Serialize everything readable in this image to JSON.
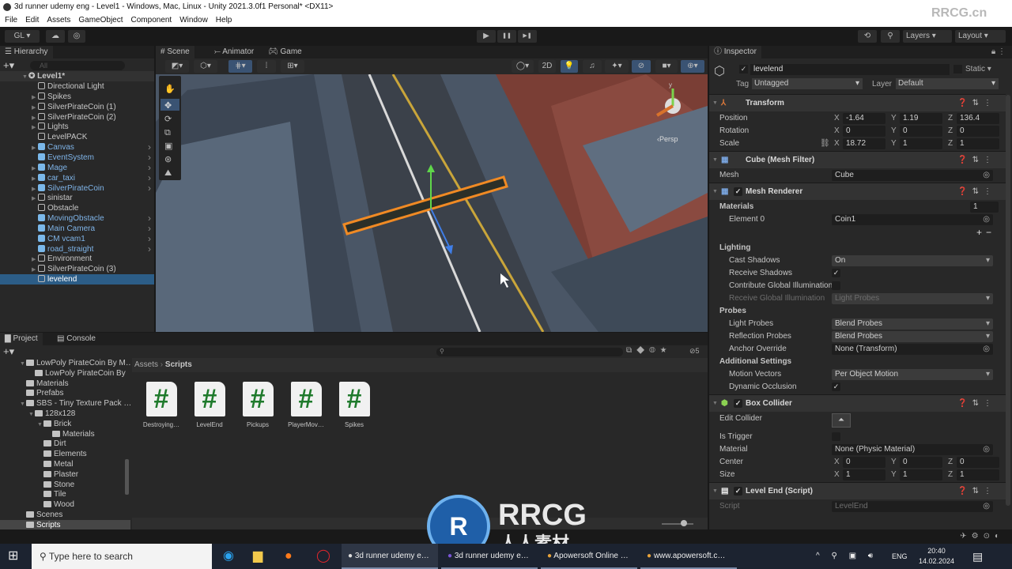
{
  "window": {
    "title": "3d runner udemy eng - Level1 - Windows, Mac, Linux - Unity 2021.3.0f1 Personal* <DX11>"
  },
  "menu": [
    "File",
    "Edit",
    "Assets",
    "GameObject",
    "Component",
    "Window",
    "Help"
  ],
  "toolbar": {
    "account": "GL ▾",
    "layers": "Layers",
    "layout": "Layout",
    "play": "▶",
    "pause": "❚❚",
    "step": "▶❚"
  },
  "hierarchy": {
    "tab": "Hierarchy",
    "search_placeholder": "All",
    "scene": "Level1*",
    "items": [
      {
        "name": "Directional Light",
        "prefab": false,
        "expandable": false,
        "selected": false
      },
      {
        "name": "Spikes",
        "prefab": false,
        "expandable": true,
        "selected": false
      },
      {
        "name": "SilverPirateCoin (1)",
        "prefab": false,
        "expandable": true,
        "selected": false
      },
      {
        "name": "SilverPirateCoin (2)",
        "prefab": false,
        "expandable": true,
        "selected": false
      },
      {
        "name": "Lights",
        "prefab": false,
        "expandable": true,
        "selected": false
      },
      {
        "name": "LevelPACK",
        "prefab": false,
        "expandable": false,
        "selected": false
      },
      {
        "name": "Canvas",
        "prefab": true,
        "expandable": true,
        "selected": false
      },
      {
        "name": "EventSystem",
        "prefab": true,
        "expandable": false,
        "selected": false
      },
      {
        "name": "Mage",
        "prefab": true,
        "expandable": true,
        "selected": false
      },
      {
        "name": "car_taxi",
        "prefab": true,
        "expandable": true,
        "selected": false
      },
      {
        "name": "SilverPirateCoin",
        "prefab": true,
        "expandable": true,
        "selected": false
      },
      {
        "name": "sinistar",
        "prefab": false,
        "expandable": true,
        "selected": false
      },
      {
        "name": "Obstacle",
        "prefab": false,
        "expandable": false,
        "selected": false
      },
      {
        "name": "MovingObstacle",
        "prefab": true,
        "expandable": false,
        "selected": false
      },
      {
        "name": "Main Camera",
        "prefab": true,
        "expandable": false,
        "selected": false
      },
      {
        "name": "CM vcam1",
        "prefab": true,
        "expandable": false,
        "selected": false
      },
      {
        "name": "road_straight",
        "prefab": true,
        "expandable": false,
        "selected": false
      },
      {
        "name": "Environment",
        "prefab": false,
        "expandable": true,
        "selected": false
      },
      {
        "name": "SilverPirateCoin (3)",
        "prefab": false,
        "expandable": true,
        "selected": false
      },
      {
        "name": "levelend",
        "prefab": false,
        "expandable": false,
        "selected": true
      }
    ]
  },
  "scene": {
    "tabs": [
      "Scene",
      "Animator",
      "Game"
    ],
    "mode_2d": "2D",
    "persp_label": "‹Persp",
    "gizmo_y": "y"
  },
  "project": {
    "tabs": [
      "Project",
      "Console"
    ],
    "breadcrumb": [
      "Assets",
      "Scripts"
    ],
    "badge": "5",
    "tree": [
      {
        "name": "LowPoly PirateCoin By M…",
        "depth": 1,
        "open": true
      },
      {
        "name": "LowPoly PirateCoin By",
        "depth": 2,
        "open": false
      },
      {
        "name": "Materials",
        "depth": 1,
        "open": false
      },
      {
        "name": "Prefabs",
        "depth": 1,
        "open": false
      },
      {
        "name": "SBS - Tiny Texture Pack …",
        "depth": 1,
        "open": true
      },
      {
        "name": "128x128",
        "depth": 2,
        "open": true
      },
      {
        "name": "Brick",
        "depth": 3,
        "open": true
      },
      {
        "name": "Materials",
        "depth": 4,
        "open": false
      },
      {
        "name": "Dirt",
        "depth": 3,
        "open": false
      },
      {
        "name": "Elements",
        "depth": 3,
        "open": false
      },
      {
        "name": "Metal",
        "depth": 3,
        "open": false
      },
      {
        "name": "Plaster",
        "depth": 3,
        "open": false
      },
      {
        "name": "Stone",
        "depth": 3,
        "open": false
      },
      {
        "name": "Tile",
        "depth": 3,
        "open": false
      },
      {
        "name": "Wood",
        "depth": 3,
        "open": false
      },
      {
        "name": "Scenes",
        "depth": 1,
        "open": false
      },
      {
        "name": "Scripts",
        "depth": 1,
        "open": false,
        "selected": true
      }
    ],
    "assets": [
      "Destroying…",
      "LevelEnd",
      "Pickups",
      "PlayerMov…",
      "Spikes"
    ]
  },
  "inspector": {
    "tab": "Inspector",
    "object_name": "levelend",
    "static": "Static",
    "tag_label": "Tag",
    "tag": "Untagged",
    "layer_label": "Layer",
    "layer": "Default",
    "components": [
      {
        "title": "Transform",
        "icon": "transform-icon",
        "checkbox": false,
        "rows": [
          {
            "type": "vec3",
            "label": "Position",
            "x": "-1.64",
            "y": "1.19",
            "z": "136.4"
          },
          {
            "type": "vec3",
            "label": "Rotation",
            "x": "0",
            "y": "0",
            "z": "0"
          },
          {
            "type": "vec3",
            "label": "Scale",
            "x": "18.72",
            "y": "1",
            "z": "1",
            "link": true
          }
        ]
      },
      {
        "title": "Cube (Mesh Filter)",
        "icon": "mesh-filter-icon",
        "checkbox": false,
        "rows": [
          {
            "type": "obj",
            "label": "Mesh",
            "value": "Cube"
          }
        ]
      },
      {
        "title": "Mesh Renderer",
        "icon": "mesh-renderer-icon",
        "checkbox": true,
        "rows": [
          {
            "type": "section",
            "label": "Materials",
            "count": "1"
          },
          {
            "type": "obj",
            "label": "Element 0",
            "value": "Coin1",
            "sub": true
          },
          {
            "type": "plusminus"
          },
          {
            "type": "section",
            "label": "Lighting"
          },
          {
            "type": "dd",
            "label": "Cast Shadows",
            "value": "On",
            "sub": true
          },
          {
            "type": "check",
            "label": "Receive Shadows",
            "checked": true,
            "sub": true
          },
          {
            "type": "check",
            "label": "Contribute Global Illumination",
            "checked": false,
            "sub": true
          },
          {
            "type": "dd",
            "label": "Receive Global Illumination",
            "value": "Light Probes",
            "sub": true,
            "dim": true
          },
          {
            "type": "section",
            "label": "Probes"
          },
          {
            "type": "dd",
            "label": "Light Probes",
            "value": "Blend Probes",
            "sub": true
          },
          {
            "type": "dd",
            "label": "Reflection Probes",
            "value": "Blend Probes",
            "sub": true
          },
          {
            "type": "obj",
            "label": "Anchor Override",
            "value": "None (Transform)",
            "sub": true
          },
          {
            "type": "section",
            "label": "Additional Settings"
          },
          {
            "type": "dd",
            "label": "Motion Vectors",
            "value": "Per Object Motion",
            "sub": true
          },
          {
            "type": "check",
            "label": "Dynamic Occlusion",
            "checked": true,
            "sub": true
          }
        ]
      },
      {
        "title": "Box Collider",
        "icon": "box-collider-icon",
        "checkbox": true,
        "rows": [
          {
            "type": "button",
            "label": "Edit Collider"
          },
          {
            "type": "check",
            "label": "Is Trigger",
            "checked": false
          },
          {
            "type": "obj",
            "label": "Material",
            "value": "None (Physic Material)"
          },
          {
            "type": "vec3",
            "label": "Center",
            "x": "0",
            "y": "0",
            "z": "0"
          },
          {
            "type": "vec3",
            "label": "Size",
            "x": "1",
            "y": "1",
            "z": "1"
          }
        ]
      },
      {
        "title": "Level End (Script)",
        "icon": "script-icon",
        "checkbox": true,
        "rows": [
          {
            "type": "obj",
            "label": "Script",
            "value": "LevelEnd",
            "dim": true
          }
        ]
      }
    ]
  },
  "taskbar": {
    "search_placeholder": "Type here to search",
    "apps": [
      "3d runner udemy e…",
      "3d runner udemy e…",
      "Apowersoft Online …",
      "www.apowersoft.c…"
    ],
    "lang": "ENG",
    "time": "20:40",
    "date": "14.02.2024"
  },
  "watermark": {
    "text": "RRCG",
    "sub": "人人素材",
    "corner": "RRCG.cn"
  },
  "colors": {
    "accent": "#2c5d87",
    "prefab": "#7fb4e8",
    "script_hash": "#1f7a2c"
  }
}
